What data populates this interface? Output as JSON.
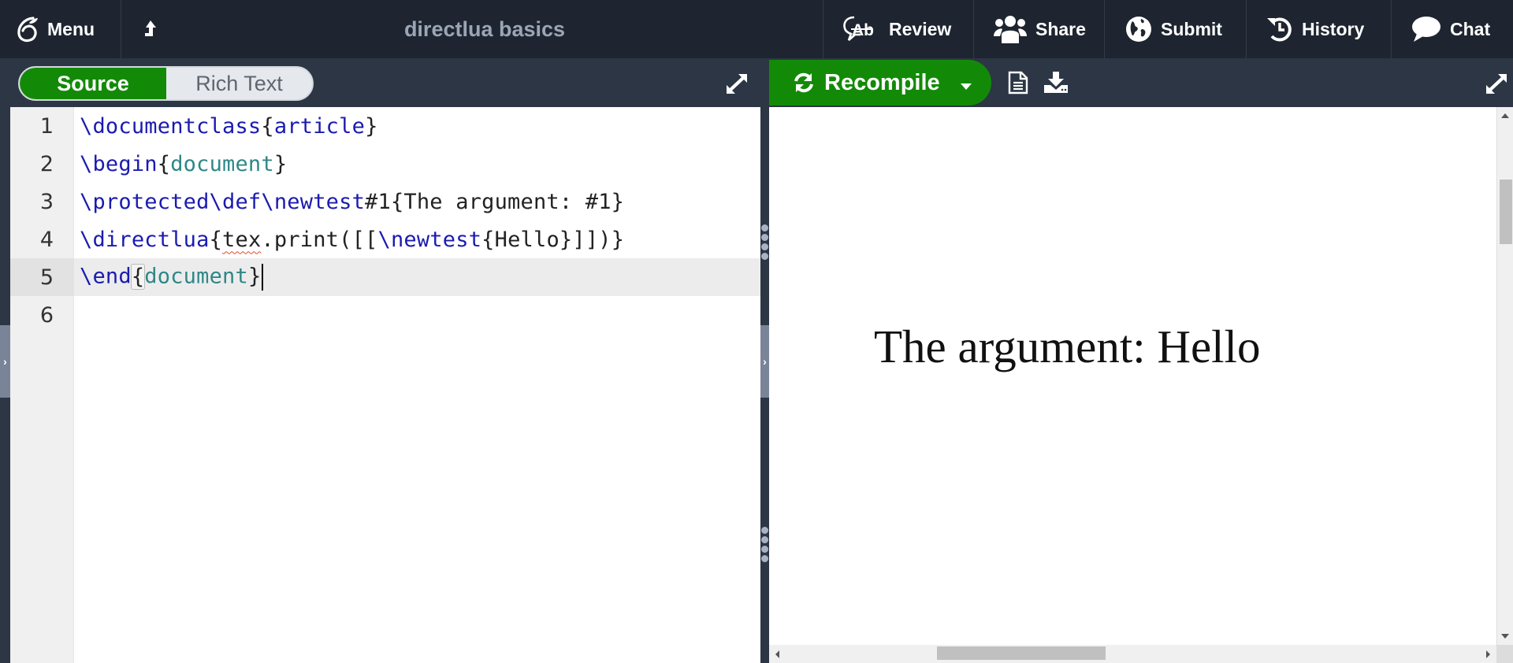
{
  "topbar": {
    "menu_label": "Menu",
    "project_title": "directlua basics",
    "items": [
      {
        "label": "Review",
        "icon": "review-icon"
      },
      {
        "label": "Share",
        "icon": "share-users-icon"
      },
      {
        "label": "Submit",
        "icon": "globe-icon"
      },
      {
        "label": "History",
        "icon": "history-icon"
      },
      {
        "label": "Chat",
        "icon": "chat-bubble-icon"
      }
    ]
  },
  "editor_toolbar": {
    "mode_options": [
      {
        "label": "Source",
        "active": true
      },
      {
        "label": "Rich Text",
        "active": false
      }
    ]
  },
  "pdf_toolbar": {
    "recompile_label": "Recompile"
  },
  "editor": {
    "active_line": 5,
    "lines": [
      {
        "number": "1",
        "tokens": [
          {
            "t": "\\documentclass",
            "c": "kw"
          },
          {
            "t": "{",
            "c": ""
          },
          {
            "t": "article",
            "c": "kw"
          },
          {
            "t": "}",
            "c": ""
          }
        ]
      },
      {
        "number": "2",
        "fold": true,
        "tokens": [
          {
            "t": "\\begin",
            "c": "kw"
          },
          {
            "t": "{",
            "c": ""
          },
          {
            "t": "document",
            "c": "arg"
          },
          {
            "t": "}",
            "c": ""
          }
        ]
      },
      {
        "number": "3",
        "tokens": [
          {
            "t": "\\protected\\def\\newtest",
            "c": "kw"
          },
          {
            "t": "#1{The argument: #1}",
            "c": ""
          }
        ]
      },
      {
        "number": "4",
        "tokens": [
          {
            "t": "\\directlua",
            "c": "kw"
          },
          {
            "t": "{",
            "c": ""
          },
          {
            "t": "tex",
            "c": "squiggle"
          },
          {
            "t": ".print([[",
            "c": ""
          },
          {
            "t": "\\newtest",
            "c": "kw"
          },
          {
            "t": "{Hello}]])}",
            "c": ""
          }
        ]
      },
      {
        "number": "5",
        "tokens": [
          {
            "t": "\\end",
            "c": "kw"
          },
          {
            "t": "{",
            "c": "brk-match"
          },
          {
            "t": "document",
            "c": "arg"
          },
          {
            "t": "}",
            "c": ""
          }
        ]
      },
      {
        "number": "6",
        "tokens": []
      }
    ]
  },
  "pdf": {
    "rendered_text": "The argument:  Hello"
  },
  "colors": {
    "topbar_bg": "#1e2530",
    "toolbar_bg": "#2c3645",
    "accent_green": "#138a07",
    "keyword_blue": "#1b1bb0",
    "argument_teal": "#2f8787"
  }
}
